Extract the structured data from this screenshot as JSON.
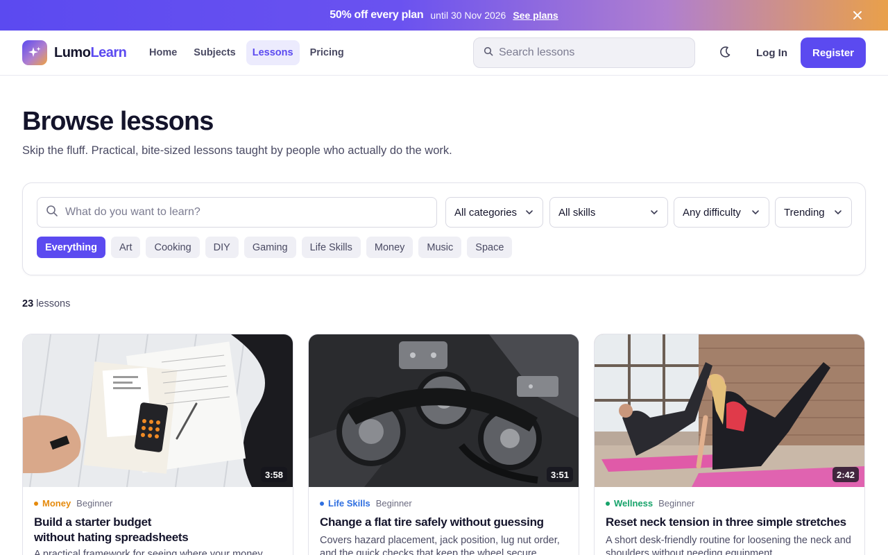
{
  "promo": {
    "headline": "50% off every plan",
    "until": "until 30 Nov 2026",
    "link": "See plans"
  },
  "nav": {
    "logo_part1": "Lumo",
    "logo_part2": "Learn",
    "links": [
      "Home",
      "Subjects",
      "Lessons",
      "Pricing"
    ],
    "active": "Lessons",
    "search_placeholder": "Search lessons",
    "login": "Log In",
    "register": "Register"
  },
  "page": {
    "title": "Browse lessons",
    "subtitle": "Skip the fluff. Practical, bite-sized lessons taught by people who actually do the work."
  },
  "filters": {
    "search_placeholder": "What do you want to learn?",
    "category": "All categories",
    "skills": "All skills",
    "difficulty": "Any difficulty",
    "sort": "Trending",
    "chips": [
      "Everything",
      "Art",
      "Cooking",
      "DIY",
      "Gaming",
      "Life Skills",
      "Money",
      "Music",
      "Space"
    ],
    "active_chip": "Everything"
  },
  "results": {
    "count": "23",
    "label": "lessons"
  },
  "colors": {
    "accent": "#5b4af0",
    "money": "#e58a0c",
    "life_skills": "#2f6fe0",
    "wellness": "#16a36a"
  },
  "cards": [
    {
      "duration": "3:58",
      "category": "Money",
      "level": "Beginner",
      "title_line1": "Build a starter budget",
      "title_line2": "without hating spreadsheets",
      "desc_line1": "A practical framework for seeing where your money",
      "image": "budget-paperwork-photo"
    },
    {
      "duration": "3:51",
      "category": "Life Skills",
      "level": "Beginner",
      "title_line1": "Change a flat tire safely without guessing",
      "desc_line1": "Covers hazard placement, jack position, lug nut order,",
      "desc_line2": "and the quick checks that keep the wheel secure.",
      "image": "car-engine-photo"
    },
    {
      "duration": "2:42",
      "category": "Wellness",
      "level": "Beginner",
      "title_line1": "Reset neck tension in three simple stretches",
      "desc_line1": "A short desk-friendly routine for loosening the neck and",
      "desc_line2": "shoulders without needing equipment.",
      "image": "yoga-class-photo"
    }
  ]
}
